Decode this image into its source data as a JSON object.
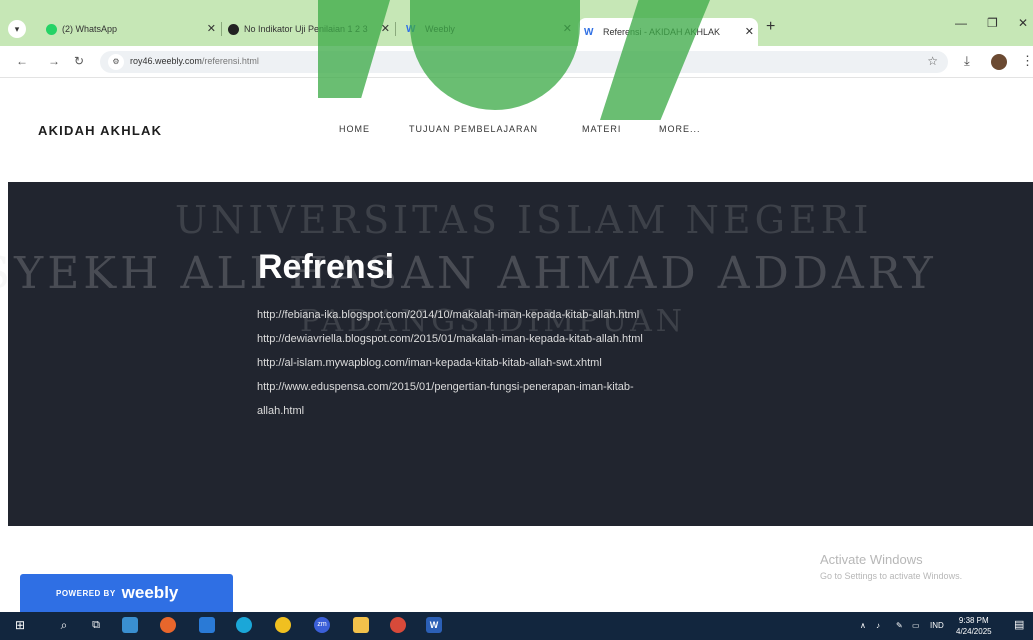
{
  "browser": {
    "tabs": [
      {
        "title": "(2) WhatsApp",
        "icon": "whatsapp-icon",
        "color": "#25d366"
      },
      {
        "title": "No Indikator Uji Penilaian 1 2 3",
        "icon": "globe-icon",
        "color": "#222222"
      },
      {
        "title": "Weebly",
        "icon": "weebly-icon",
        "color": "#2f6fe4"
      },
      {
        "title": "Referensi - AKIDAH AKHLAK",
        "icon": "weebly-icon",
        "color": "#2f6fe4"
      }
    ],
    "url_host": "roy46.weebly.com",
    "url_path": "/referensi.html"
  },
  "site": {
    "title": "AKIDAH AKHLAK",
    "nav": [
      "HOME",
      "TUJUAN PEMBELAJARAN",
      "MATERI",
      "MORE..."
    ]
  },
  "content": {
    "heading": "Refrensi",
    "references": [
      "http://febiana-ika.blogspot.com/2014/10/makalah-iman-kepada-kitab-allah.html",
      "http://dewiavriella.blogspot.com/2015/01/makalah-iman-kepada-kitab-allah.html",
      "http://al-islam.mywapblog.com/iman-kepada-kitab-kitab-allah-swt.xhtml",
      "http://www.eduspensa.com/2015/01/pengertian-fungsi-penerapan-iman-kitab-",
      "allah.html"
    ]
  },
  "watermark": {
    "line1": "UNIVERSITAS ISLAM NEGERI",
    "line2": "SYEKH ALI HASAN AHMAD ADDARY",
    "line3": "PADANGSIDIMPUAN"
  },
  "footer": {
    "powered_by": "POWERED BY",
    "brand": "weebly"
  },
  "activate": {
    "title": "Activate Windows",
    "subtitle": "Go to Settings to activate Windows."
  },
  "taskbar": {
    "lang": "IND",
    "time": "9:38 PM",
    "date": "4/24/2025"
  },
  "colors": {
    "tabstrip": "#c6e7b6",
    "hero_bg": "#21252f",
    "weebly_blue": "#2f6fe4",
    "taskbar": "#12263e"
  }
}
